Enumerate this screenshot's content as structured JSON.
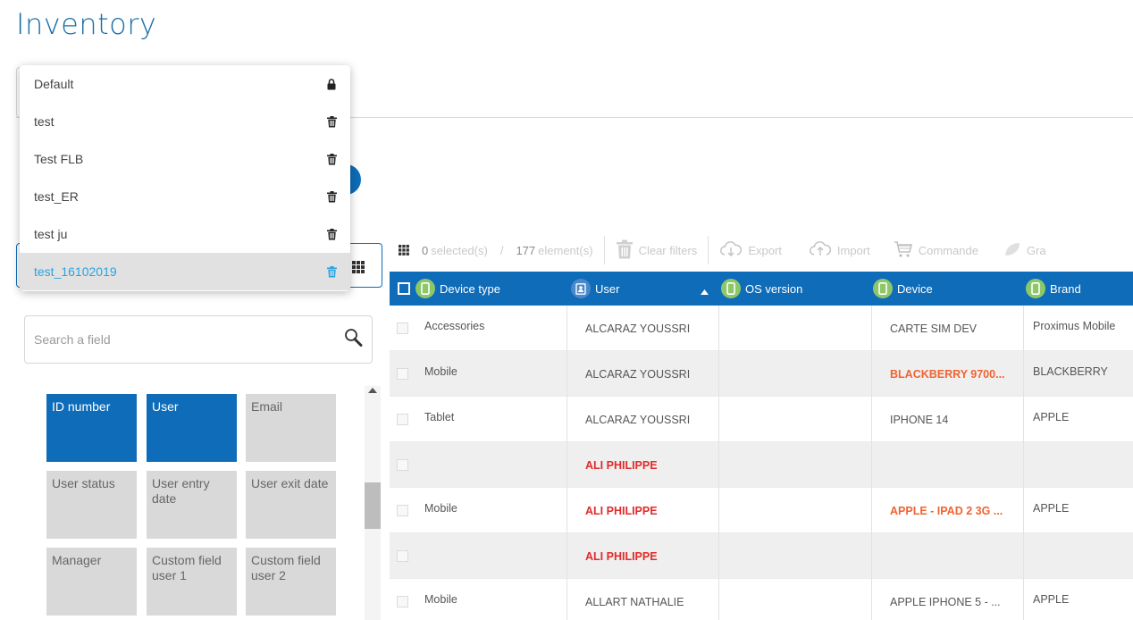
{
  "page": {
    "title": "Inventory"
  },
  "views_dropdown": {
    "items": [
      {
        "label": "Default",
        "icon": "lock-icon"
      },
      {
        "label": "test",
        "icon": "trash-icon"
      },
      {
        "label": "Test FLB",
        "icon": "trash-icon"
      },
      {
        "label": "test_ER",
        "icon": "trash-icon"
      },
      {
        "label": "test ju",
        "icon": "trash-icon"
      },
      {
        "label": "test_16102019",
        "icon": "trash-icon",
        "selected": true
      }
    ]
  },
  "field_panel": {
    "search_placeholder": "Search a field",
    "tiles": [
      {
        "label": "ID number",
        "active": true
      },
      {
        "label": "User",
        "active": true
      },
      {
        "label": "Email",
        "active": false
      },
      {
        "label": "User status",
        "active": false
      },
      {
        "label": "User entry date",
        "active": false
      },
      {
        "label": "User exit date",
        "active": false
      },
      {
        "label": "Manager",
        "active": false
      },
      {
        "label": "Custom field user 1",
        "active": false
      },
      {
        "label": "Custom field user 2",
        "active": false
      }
    ]
  },
  "toolbar": {
    "selected_count": "0",
    "selected_label": "selected(s)",
    "divider": "/",
    "total_count": "177",
    "total_label": "element(s)",
    "clear_filters": "Clear filters",
    "export": "Export",
    "import": "Import",
    "commande": "Commande",
    "truncated": "Gra"
  },
  "table": {
    "columns": {
      "device_type": "Device type",
      "user": "User",
      "os_version": "OS version",
      "device": "Device",
      "brand": "Brand"
    },
    "rows": [
      {
        "device_type": "Accessories",
        "user": "ALCARAZ YOUSSRI",
        "user_style": "normal",
        "os_version": "",
        "device": "CARTE SIM DEV",
        "device_style": "normal",
        "brand": "Proximus Mobile"
      },
      {
        "device_type": "Mobile",
        "user": "ALCARAZ YOUSSRI",
        "user_style": "normal",
        "os_version": "",
        "device": "BLACKBERRY 9700...",
        "device_style": "orange",
        "brand": "BLACKBERRY"
      },
      {
        "device_type": "Tablet",
        "user": "ALCARAZ YOUSSRI",
        "user_style": "normal",
        "os_version": "",
        "device": "IPHONE 14",
        "device_style": "normal",
        "brand": "APPLE"
      },
      {
        "device_type": "",
        "user": "ALI PHILIPPE",
        "user_style": "red",
        "os_version": "",
        "device": "",
        "device_style": "normal",
        "brand": ""
      },
      {
        "device_type": "Mobile",
        "user": "ALI PHILIPPE",
        "user_style": "red",
        "os_version": "",
        "device": "APPLE - IPAD 2 3G ...",
        "device_style": "orange",
        "brand": "APPLE"
      },
      {
        "device_type": "",
        "user": "ALI PHILIPPE",
        "user_style": "red",
        "os_version": "",
        "device": "",
        "device_style": "normal",
        "brand": ""
      },
      {
        "device_type": "Mobile",
        "user": "ALLART NATHALIE",
        "user_style": "normal",
        "os_version": "",
        "device": "APPLE IPHONE 5 - ...",
        "device_style": "normal",
        "brand": "APPLE"
      }
    ]
  },
  "colors": {
    "primary": "#0f6cb8",
    "selected_text": "#2aa3e0",
    "red": "#e12b2b",
    "orange": "#f06331",
    "device_icon": "#8ec76a"
  }
}
